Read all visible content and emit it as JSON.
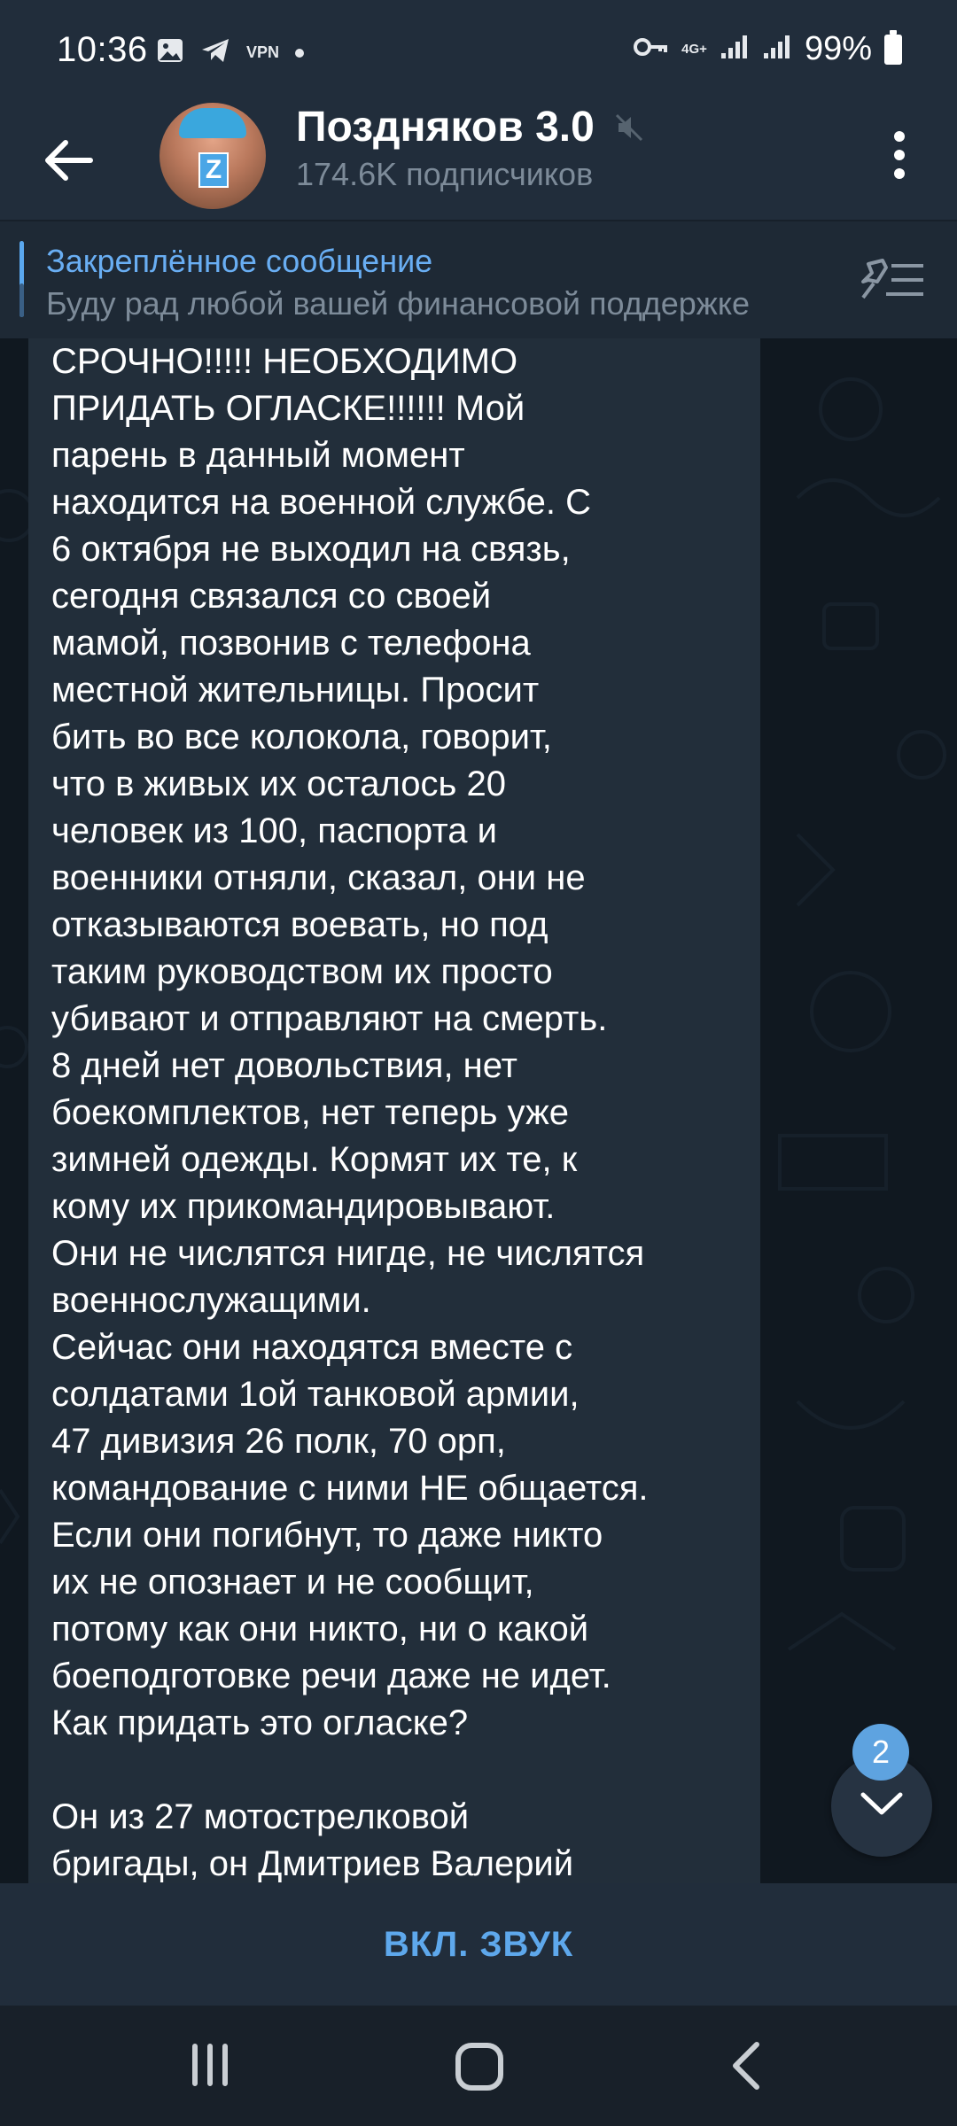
{
  "status_bar": {
    "time": "10:36",
    "vpn_label": "VPN",
    "network_label": "4G+",
    "battery": "99%",
    "icons": [
      "image-icon",
      "telegram-icon",
      "vpn-icon",
      "dot-icon",
      "key-icon",
      "signal-icon",
      "signal-icon",
      "battery-icon"
    ]
  },
  "header": {
    "title": "Поздняков 3.0",
    "subtitle": "174.6K подписчиков",
    "avatar_letter": "Z",
    "icons": [
      "back-arrow-icon",
      "muted-icon",
      "more-vertical-icon"
    ]
  },
  "pinned": {
    "title": "Закреплённое сообщение",
    "text": "Буду рад любой вашей финансовой поддержке",
    "icon": "pinned-list-icon"
  },
  "message": {
    "lines": [
      "СРОЧНО!!!!! НЕОБХОДИМО",
      "ПРИДАТЬ ОГЛАСКЕ!!!!!! Мой",
      "парень в данный момент",
      "находится на военной службе. С",
      "6 октября не выходил на связь,",
      "сегодня связался со своей",
      "мамой, позвонив с телефона",
      "местной жительницы. Просит",
      "бить во все колокола, говорит,",
      "что в живых их осталось 20",
      "человек из 100, паспорта и",
      "военники отняли, сказал, они не",
      "отказываются воевать, но под",
      "таким руководством их просто",
      "убивают и отправляют на смерть.",
      "8 дней нет довольствия, нет",
      "боекомплектов, нет теперь уже",
      "зимней одежды. Кормят их те, к",
      "кому их прикомандировывают.",
      "Они не числятся нигде, не числятся",
      "военнослужащими.",
      "Сейчас они находятся вместе с",
      "солдатами 1ой танковой армии,",
      "47 дивизия 26 полк, 70 орп,",
      "командование с ними НЕ общается.",
      "Если они погибнут, то даже никто",
      "их не опознает и не сообщит,",
      "потому как они никто, ни о какой",
      "боеподготовке речи даже не идет.",
      "Как придать это огласке?",
      "",
      "Он из 27 мотострелковой",
      "бригады, он Дмитриев Валерий"
    ]
  },
  "scroll_down": {
    "unread_count": "2",
    "icon": "chevron-down-icon"
  },
  "bottom": {
    "unmute_label": "ВКЛ. ЗВУК"
  },
  "navbar": {
    "icons": [
      "recent-apps-icon",
      "home-icon",
      "nav-back-icon"
    ]
  },
  "colors": {
    "header_bg": "#212d3b",
    "chat_bg": "#101820",
    "bubble_bg": "#222e3a",
    "accent": "#5ea8ec",
    "muted_text": "#7d8b99"
  }
}
